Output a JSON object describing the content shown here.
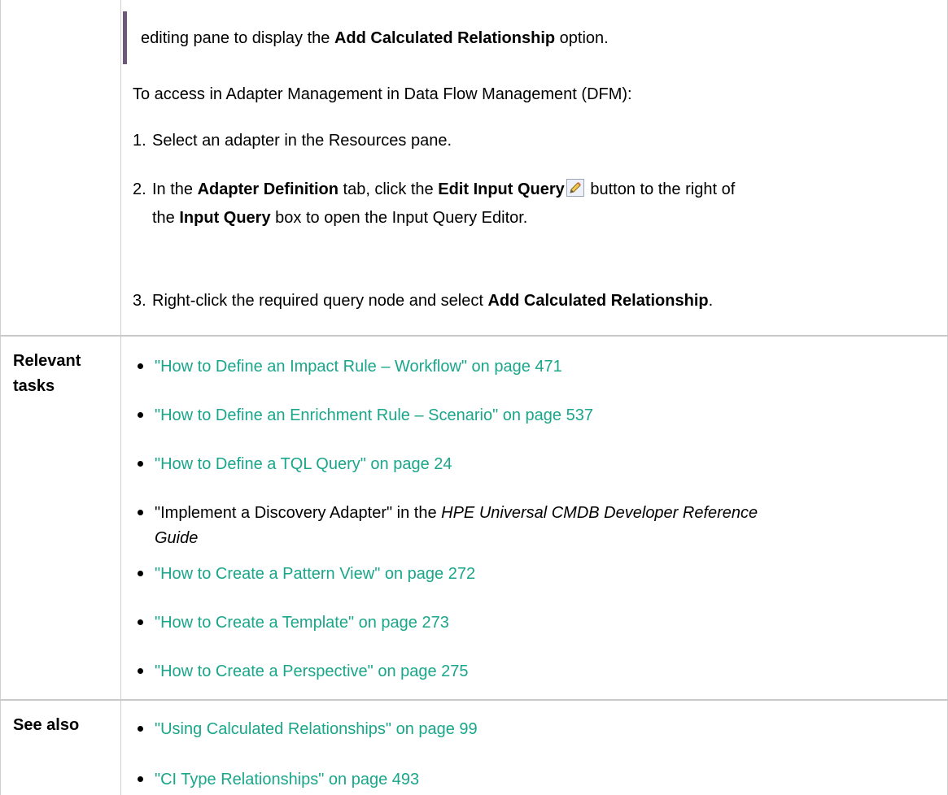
{
  "top_cell": {
    "note_line": {
      "pre": "editing pane to display the ",
      "bold": "Add Calculated Relationship",
      "post": " option."
    },
    "access_intro": "To access in Adapter Management in Data Flow Management (DFM):",
    "steps": [
      {
        "num": "1.",
        "text": "Select an adapter in the Resources pane."
      },
      {
        "num": "2.",
        "p1": "In the ",
        "b1": "Adapter Definition",
        "p2": " tab, click the ",
        "b2": "Edit Input Query",
        "p3": " button to the right of",
        "line2_p1": "the ",
        "line2_b1": "Input Query",
        "line2_p2": " box to open the Input Query Editor."
      },
      {
        "num": "3.",
        "p1": "Right-click the required query node and select ",
        "b1": "Add Calculated Relationship",
        "p2": "."
      }
    ]
  },
  "relevant_tasks": {
    "label_line1": "Relevant",
    "label_line2": "tasks",
    "items": [
      {
        "text": "\"How to Define an Impact Rule – Workflow\" on page 471"
      },
      {
        "text": "\"How to Define an Enrichment Rule – Scenario\" on page 537"
      },
      {
        "text": "\"How to Define a TQL Query\" on page 24"
      },
      {
        "p1": "\"Implement a Discovery Adapter\" in the ",
        "i1": "HPE Universal CMDB Developer Reference",
        "line2_i": "Guide"
      },
      {
        "text": "\"How to Create a Pattern View\" on page 272"
      },
      {
        "text": "\"How to Create a Template\" on page 273"
      },
      {
        "text": "\"How to Create a Perspective\" on page 275"
      }
    ]
  },
  "see_also": {
    "label": "See also",
    "items": [
      {
        "text": "\"Using Calculated Relationships\" on page 99"
      },
      {
        "text": "\"CI Type Relationships\" on page 493"
      }
    ]
  },
  "colors": {
    "link": "#1aa68a",
    "note_bar": "#6b587a",
    "grid": "#c8c8c8"
  },
  "icons": [
    "edit-pencil-icon"
  ]
}
